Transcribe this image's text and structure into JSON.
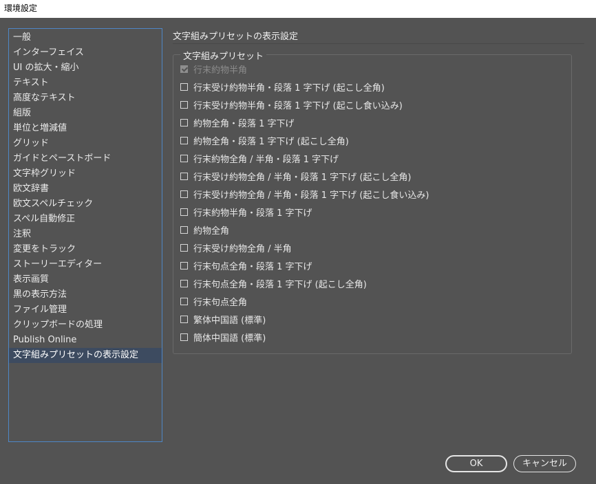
{
  "window": {
    "title": "環境設定"
  },
  "sidebar": {
    "items": [
      {
        "label": "一般"
      },
      {
        "label": "インターフェイス"
      },
      {
        "label": "UI の拡大・縮小"
      },
      {
        "label": "テキスト"
      },
      {
        "label": "高度なテキスト"
      },
      {
        "label": "組版"
      },
      {
        "label": "単位と増減値"
      },
      {
        "label": "グリッド"
      },
      {
        "label": "ガイドとペーストボード"
      },
      {
        "label": "文字枠グリッド"
      },
      {
        "label": "欧文辞書"
      },
      {
        "label": "欧文スペルチェック"
      },
      {
        "label": "スペル自動修正"
      },
      {
        "label": "注釈"
      },
      {
        "label": "変更をトラック"
      },
      {
        "label": "ストーリーエディター"
      },
      {
        "label": "表示画質"
      },
      {
        "label": "黒の表示方法"
      },
      {
        "label": "ファイル管理"
      },
      {
        "label": "クリップボードの処理"
      },
      {
        "label": "Publish Online"
      },
      {
        "label": "文字組みプリセットの表示設定",
        "selected": true
      }
    ]
  },
  "main": {
    "title": "文字組みプリセットの表示設定",
    "group_label": "文字組みプリセット",
    "options": [
      {
        "label": "行末約物半角",
        "checked": true,
        "disabled": true
      },
      {
        "label": "行末受け約物半角・段落 1 字下げ (起こし全角)",
        "checked": false
      },
      {
        "label": "行末受け約物半角・段落 1 字下げ (起こし食い込み)",
        "checked": false
      },
      {
        "label": "約物全角・段落 1 字下げ",
        "checked": false
      },
      {
        "label": "約物全角・段落 1 字下げ (起こし全角)",
        "checked": false
      },
      {
        "label": "行末約物全角 / 半角・段落 1 字下げ",
        "checked": false
      },
      {
        "label": "行末受け約物全角 / 半角・段落 1 字下げ (起こし全角)",
        "checked": false
      },
      {
        "label": "行末受け約物全角 / 半角・段落 1 字下げ (起こし食い込み)",
        "checked": false
      },
      {
        "label": "行末約物半角・段落 1 字下げ",
        "checked": false
      },
      {
        "label": "約物全角",
        "checked": false
      },
      {
        "label": "行末受け約物全角 / 半角",
        "checked": false
      },
      {
        "label": "行末句点全角・段落 1 字下げ",
        "checked": false
      },
      {
        "label": "行末句点全角・段落 1 字下げ (起こし全角)",
        "checked": false
      },
      {
        "label": "行末句点全角",
        "checked": false
      },
      {
        "label": "繁体中国語 (標準)",
        "checked": false
      },
      {
        "label": "簡体中国語 (標準)",
        "checked": false
      }
    ]
  },
  "buttons": {
    "ok": "OK",
    "cancel": "キャンセル"
  },
  "colors": {
    "background": "#535353",
    "selection": "#3d4b60",
    "sidebar_border": "#4e87c7"
  }
}
